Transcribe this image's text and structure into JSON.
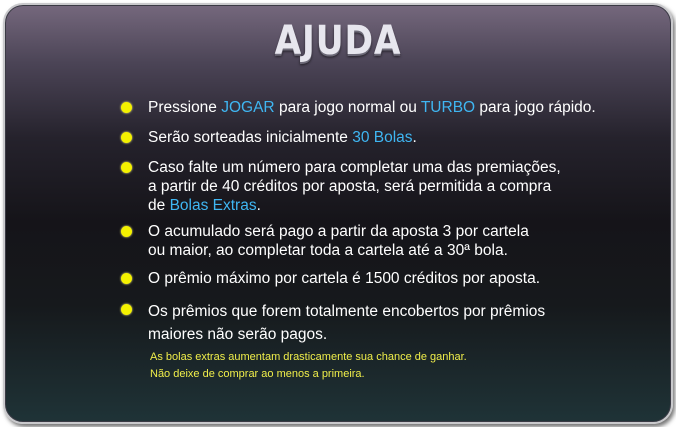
{
  "title": "AJUDA",
  "colors": {
    "highlight": "#3fb6f2",
    "bullet": "#f4f200",
    "note": "#f0ee4a",
    "text": "#ffffff"
  },
  "items": [
    {
      "parts": [
        "Pressione ",
        "JOGAR",
        " para jogo normal ou ",
        "TURBO",
        " para jogo rápido."
      ]
    },
    {
      "parts": [
        "Serão sorteadas inicialmente ",
        "30 Bolas",
        "."
      ]
    },
    {
      "line1": "Caso falte um número para completar uma das premiações,",
      "line2": "a partir de 40 créditos por aposta, será permitida a compra",
      "line3_pre": "de ",
      "line3_hl": "Bolas Extras",
      "line3_post": "."
    },
    {
      "line1": "O acumulado será pago a partir da aposta 3 por cartela",
      "line2": "ou maior, ao completar toda a cartela até a 30ª bola."
    },
    {
      "text": "O prêmio máximo por cartela é 1500 créditos por aposta."
    },
    {
      "line1": "Os prêmios que forem totalmente encobertos por prêmios",
      "line2": "maiores não serão pagos."
    }
  ],
  "note": {
    "line1": "As bolas extras aumentam drasticamente sua chance de ganhar.",
    "line2": "Não deixe de comprar ao menos a primeira."
  }
}
